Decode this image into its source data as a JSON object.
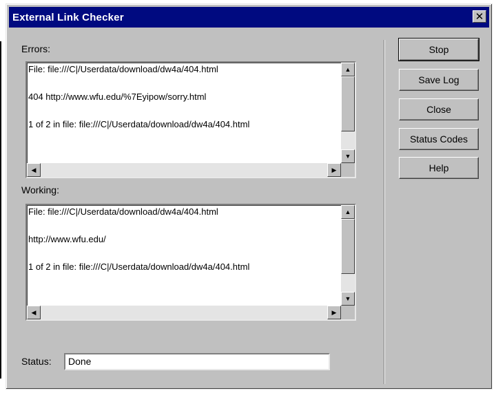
{
  "window": {
    "title": "External Link Checker",
    "close_glyph": "✕"
  },
  "errors": {
    "label": "Errors:",
    "lines": [
      "File: file:///C|/Userdata/download/dw4a/404.html",
      "404 http://www.wfu.edu/%7Eyipow/sorry.html",
      "1 of 2 in file: file:///C|/Userdata/download/dw4a/404.html"
    ]
  },
  "working": {
    "label": "Working:",
    "lines": [
      "File: file:///C|/Userdata/download/dw4a/404.html",
      "http://www.wfu.edu/",
      "1 of 2 in file: file:///C|/Userdata/download/dw4a/404.html"
    ]
  },
  "status": {
    "label": "Status:",
    "value": "Done"
  },
  "buttons": {
    "stop": "Stop",
    "save_log": "Save Log",
    "close": "Close",
    "status_codes": "Status Codes",
    "help": "Help"
  },
  "scroll_glyphs": {
    "up": "▲",
    "down": "▼",
    "left": "◀",
    "right": "▶"
  }
}
